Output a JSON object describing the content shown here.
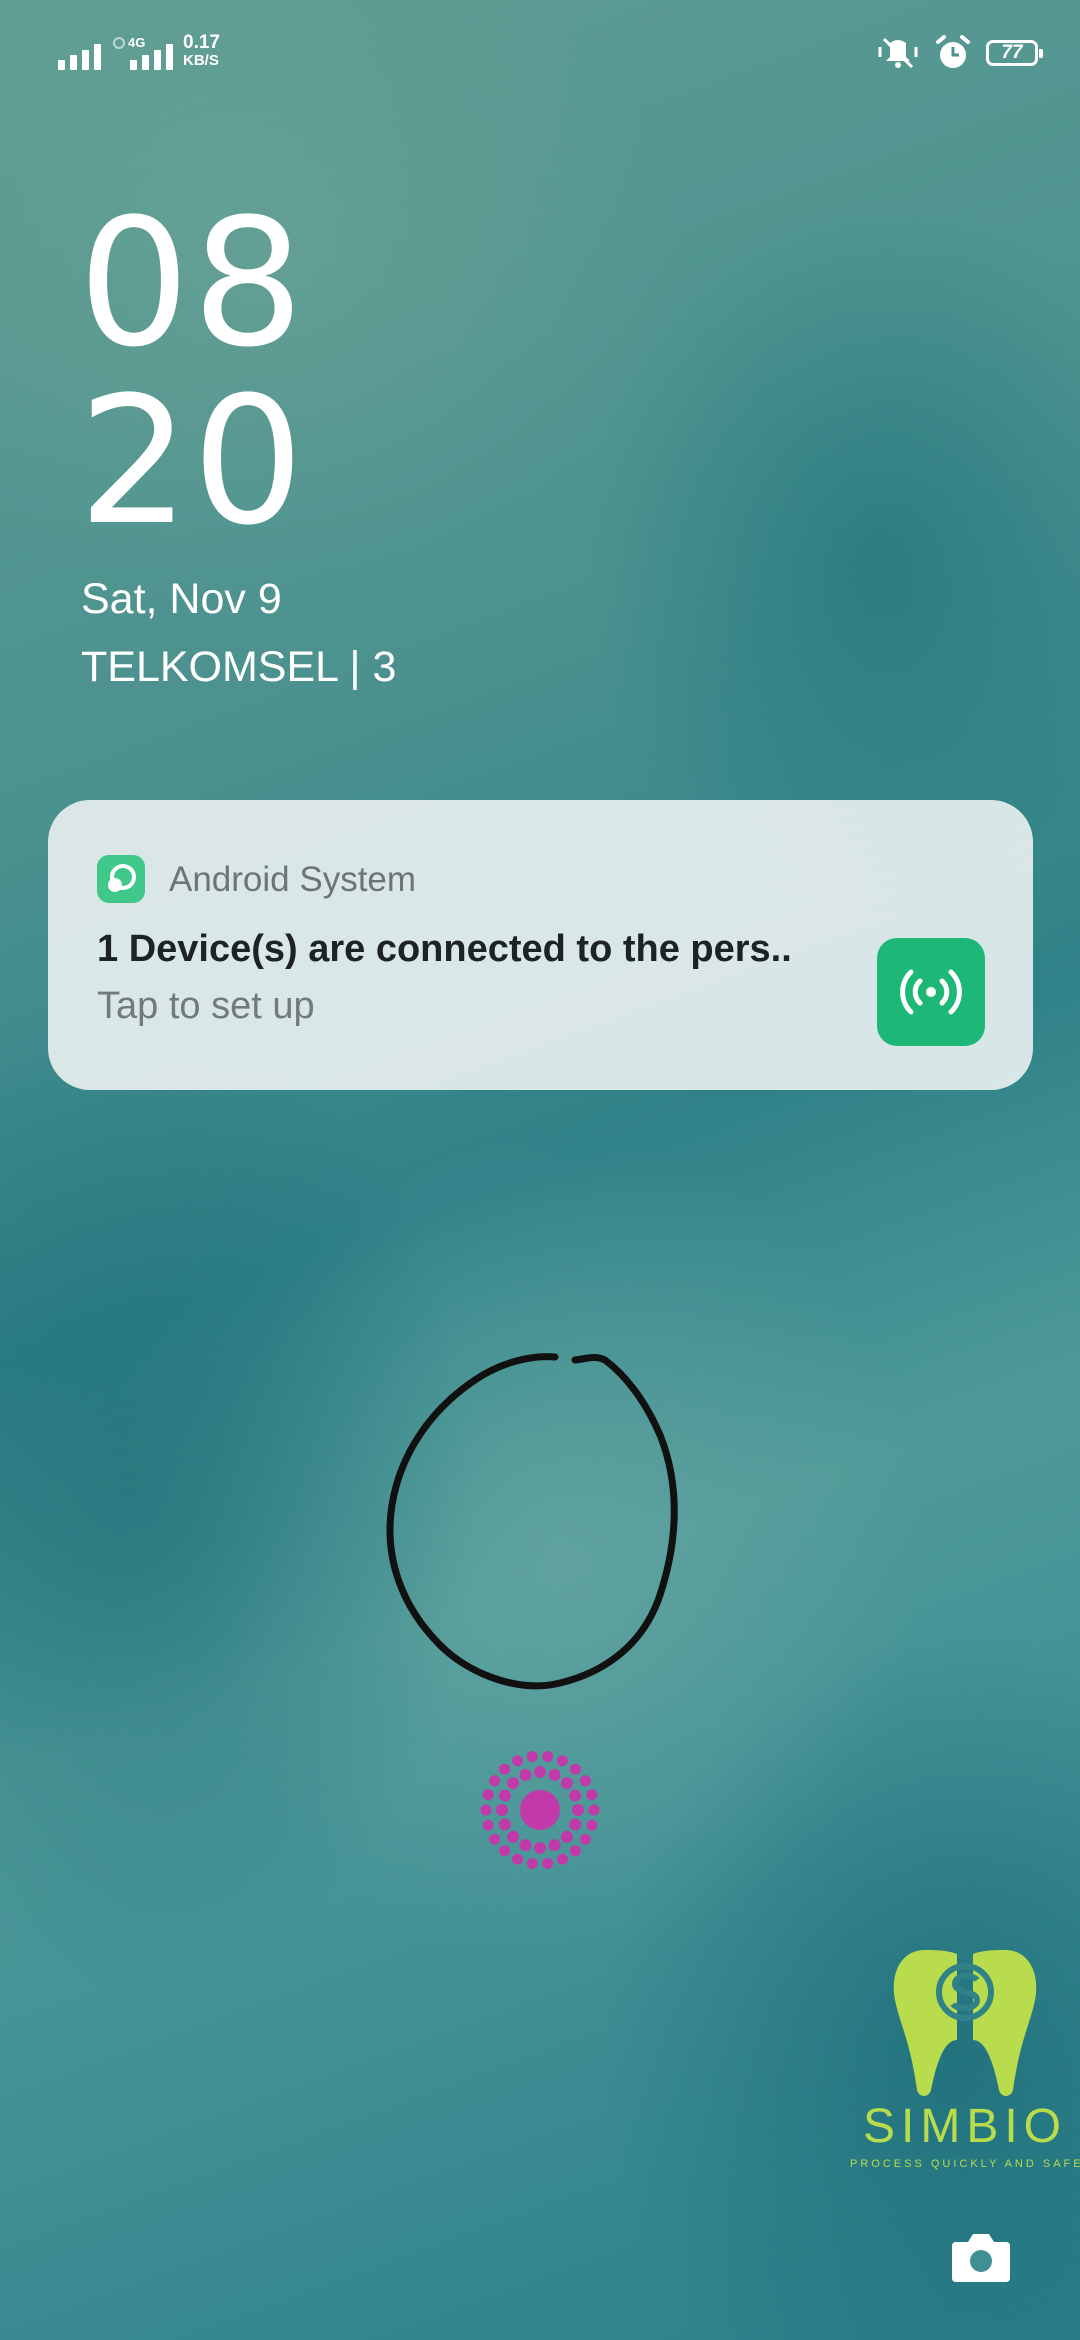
{
  "status_bar": {
    "network_type": "4G",
    "speed_value": "0.17",
    "speed_unit": "KB/S",
    "battery": "77",
    "icons": [
      "signal-icon",
      "signal-icon",
      "mute-vibrate-icon",
      "alarm-icon",
      "battery-icon"
    ]
  },
  "lockscreen": {
    "hour": "08",
    "minute": "20",
    "date": "Sat, Nov 9",
    "carrier": "TELKOMSEL | 3"
  },
  "notification": {
    "app_name": "Android System",
    "title": "1 Device(s) are connected to the pers..",
    "text": "Tap to set up",
    "app_icon": "android-system-icon",
    "large_icon": "hotspot-icon",
    "accent_color": "#1db877"
  },
  "logo": {
    "name": "SIMBIO",
    "tagline": "PROCESS QUICKLY AND SAFELY",
    "color": "#b8dc4c"
  },
  "shortcuts": {
    "camera_icon": "camera-icon"
  },
  "fingerprint_color": "#c23aa9"
}
